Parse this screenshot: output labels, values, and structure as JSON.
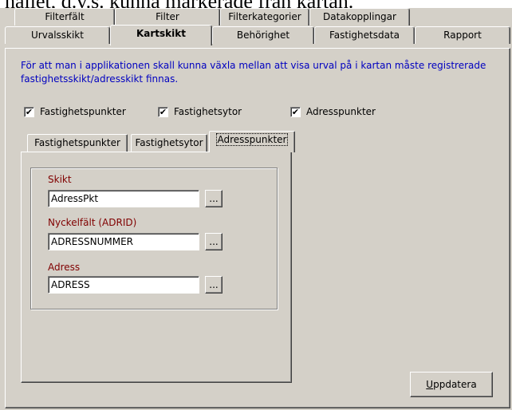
{
  "top_text": "hallet, d.v.s. kunna markerade från kartan.",
  "tabs_row1": [
    {
      "label": "Filterfält"
    },
    {
      "label": "Filter"
    },
    {
      "label": "Filterkategorier"
    },
    {
      "label": "Datakopplingar"
    }
  ],
  "tabs_row2": [
    {
      "label": "Urvalsskikt"
    },
    {
      "label": "Kartskikt",
      "active": true
    },
    {
      "label": "Behörighet"
    },
    {
      "label": "Fastighetsdata"
    },
    {
      "label": "Rapport"
    }
  ],
  "info_text": "För att man i applikationen skall kunna växla mellan att visa urval på i kartan måste registrerade fastighetsskikt/adresskikt finnas.",
  "checkboxes": [
    {
      "label": "Fastighetspunkter",
      "checked": true,
      "mark": "✔"
    },
    {
      "label": "Fastighetsytor",
      "checked": true,
      "mark": "✔"
    },
    {
      "label": "Adresspunkter",
      "checked": true,
      "mark": "✔"
    }
  ],
  "subtabs": [
    {
      "label": "Fastighetspunkter"
    },
    {
      "label": "Fastighetsytor"
    },
    {
      "label": "Adresspunkter",
      "active": true
    }
  ],
  "fields": [
    {
      "label": "Skikt",
      "value": "AdressPkt",
      "button": "..."
    },
    {
      "label": "Nyckelfält (ADRID)",
      "value": "ADRESSNUMMER",
      "button": "..."
    },
    {
      "label": "Adress",
      "value": "ADRESS",
      "button": "..."
    }
  ],
  "update_button": {
    "accel": "U",
    "rest": "ppdatera"
  },
  "colors": {
    "dialog_bg": "#d4d0c8",
    "info_text": "#0000c0",
    "field_label": "#800000"
  }
}
